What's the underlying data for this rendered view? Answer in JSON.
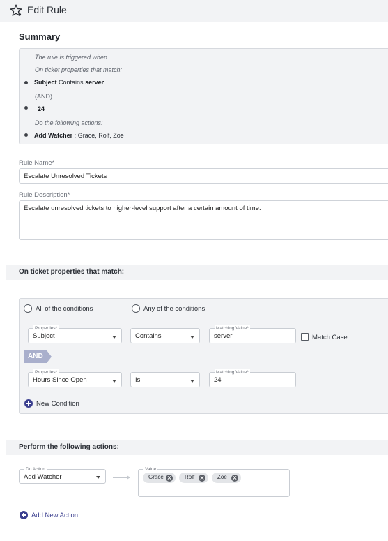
{
  "header": {
    "title": "Edit Rule"
  },
  "summary": {
    "title": "Summary",
    "triggered_when": "The rule is triggered when",
    "on_ticket_props": "On ticket properties that match:",
    "cond1_field": "Subject",
    "cond1_operator": "Contains",
    "cond1_value": "server",
    "joiner": "(AND)",
    "cond2_value": "24",
    "do_actions": "Do the following actions:",
    "action_name": "Add Watcher",
    "action_sep": " : ",
    "action_values": "Grace, Rolf, Zoe"
  },
  "rule": {
    "name_label": "Rule Name*",
    "name_value": "Escalate Unresolved Tickets",
    "desc_label": "Rule Description*",
    "desc_value": "Escalate unresolved tickets to higher-level support after a certain amount of time."
  },
  "conditions": {
    "section_title": "On ticket properties that match:",
    "all_label": "All of the conditions",
    "any_label": "Any of the conditions",
    "properties_label": "Properties*",
    "matching_label": "Matching Value*",
    "row1": {
      "property": "Subject",
      "operator": "Contains",
      "value": "server"
    },
    "match_case_label": "Match Case",
    "and_badge": "AND",
    "row2": {
      "property": "Hours Since Open",
      "operator": "Is",
      "value": "24"
    },
    "new_condition": "New Condition"
  },
  "actions": {
    "section_title": "Perform the following actions:",
    "do_action_label": "Do Action",
    "do_action_value": "Add Watcher",
    "value_label": "Value",
    "chips": [
      "Grace",
      "Rolf",
      "Zoe"
    ],
    "add_new_action": "Add New Action"
  },
  "colors": {
    "accent": "#3b3f8f",
    "and_badge": "#a9afcc",
    "panel_bg": "#f2f3f5"
  }
}
